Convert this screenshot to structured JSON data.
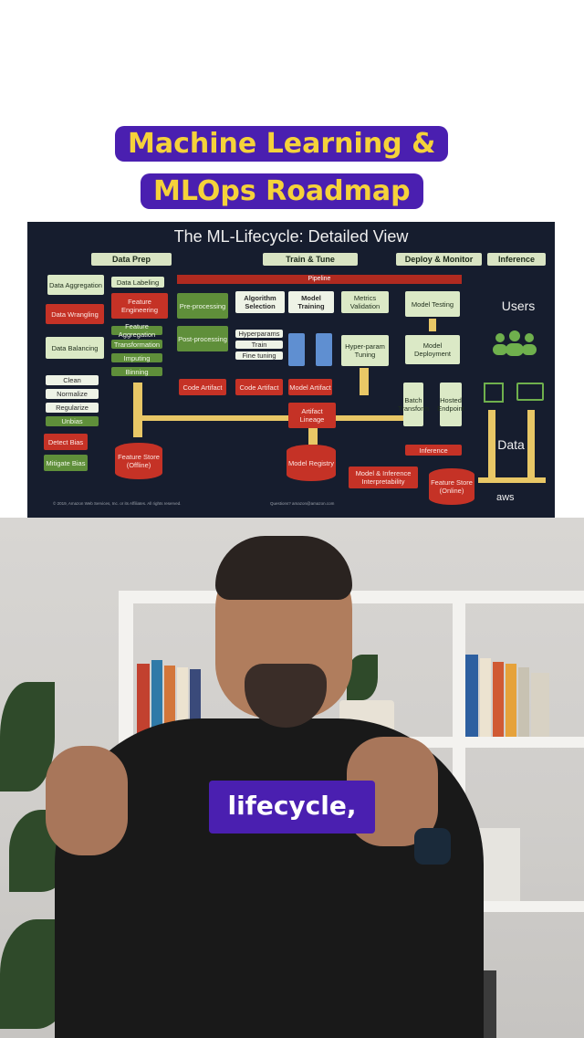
{
  "title": {
    "line1": "Machine Learning &",
    "line2": "MLOps Roadmap"
  },
  "slide": {
    "title": "The ML-Lifecycle: Detailed View",
    "headers": [
      "Data Prep",
      "Train & Tune",
      "Deploy & Monitor",
      "Inference"
    ],
    "pipeline": "Pipeline",
    "data_prep": {
      "data_aggregation": "Data Aggregation",
      "data_labeling": "Data Labeling",
      "data_wrangling": "Data Wrangling",
      "feature_engineering": "Feature Engineering",
      "pre_processing": "Pre-processing",
      "data_balancing": "Data Balancing",
      "fe_list": [
        "Feature Aggregation",
        "Transformation",
        "Imputing",
        "Binning"
      ],
      "clean_list": [
        "Clean",
        "Normalize",
        "Regularize",
        "Unbias"
      ],
      "post_processing": "Post-processing",
      "code_artifact": "Code Artifact",
      "detect_bias": "Detect Bias",
      "mitigate_bias": "Mitigate Bias",
      "feature_store_offline": "Feature Store (Offline)"
    },
    "train": {
      "algorithm_selection": "Algorithm Selection",
      "model_training": "Model Training",
      "metrics_validation": "Metrics Validation",
      "algo_list": [
        "Hyperparams",
        "Train",
        "Fine tuning"
      ],
      "hyper_param_tuning": "Hyper-param Tuning",
      "code_artifact": "Code Artifact",
      "model_artifact": "Model Artifact",
      "artifact_lineage": "Artifact Lineage",
      "model_registry": "Model Registry"
    },
    "deploy": {
      "model_testing": "Model Testing",
      "model_deployment": "Model Deployment",
      "batch_transform": "Batch Transform",
      "hosted_endpoint": "Hosted Endpoint",
      "inference": "Inference",
      "interpretability": "Model & Inference Interpretability",
      "feature_store_online": "Feature Store (Online)"
    },
    "inference_col": {
      "users": "Users",
      "data": "Data"
    },
    "footer_left": "© 2019, Amazon Web Services, Inc. or its Affiliates. All rights reserved.",
    "footer_mid": "Questions? amazon@amazon.com",
    "aws": "aws"
  },
  "caption": "lifecycle,",
  "colors": {
    "accent": "#4a1fb0",
    "title_text": "#f5d23a",
    "slide_bg": "#161d2e",
    "red": "#c53226",
    "green": "#dbe9c6"
  }
}
